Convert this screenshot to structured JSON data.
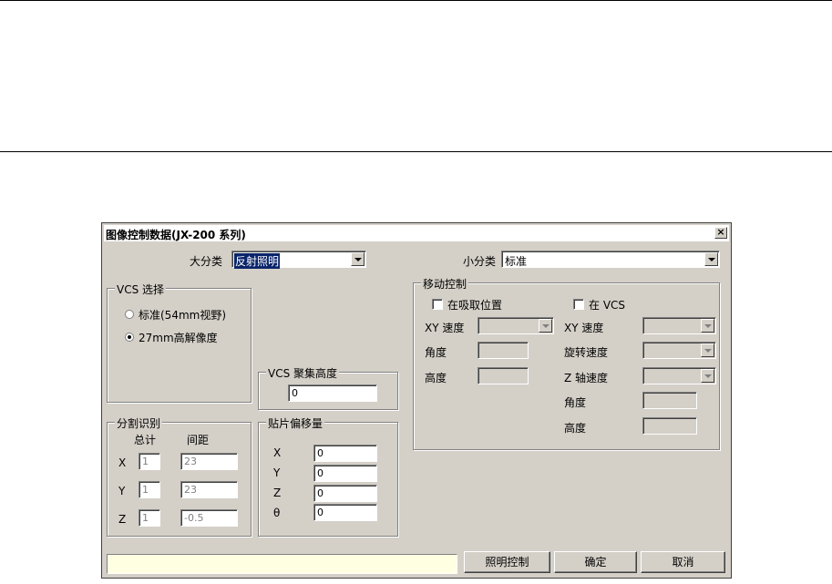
{
  "dialog": {
    "title": "图像控制数据(JX-200 系列)",
    "close_glyph": "×"
  },
  "category": {
    "major_label": "大分类",
    "major_value": "反射照明",
    "minor_label": "小分类",
    "minor_value": "标准"
  },
  "vcs_select": {
    "legend": "VCS 选择",
    "options": [
      {
        "label": "标准(54mm视野)",
        "checked": false
      },
      {
        "label": "27mm高解像度",
        "checked": true
      }
    ]
  },
  "vcs_focus": {
    "legend": "VCS 聚集高度",
    "value": "0"
  },
  "split": {
    "legend": "分割识别",
    "col_total": "总计",
    "col_pitch": "间距",
    "rows": [
      {
        "axis": "X",
        "total": "1",
        "pitch": "23"
      },
      {
        "axis": "Y",
        "total": "1",
        "pitch": "23"
      },
      {
        "axis": "Z",
        "total": "1",
        "pitch": "-0.5"
      }
    ]
  },
  "offset": {
    "legend": "贴片偏移量",
    "rows": [
      {
        "axis": "X",
        "value": "0"
      },
      {
        "axis": "Y",
        "value": "0"
      },
      {
        "axis": "Z",
        "value": "0"
      },
      {
        "axis": "θ",
        "value": "0"
      }
    ]
  },
  "move": {
    "legend": "移动控制",
    "pick_check": "在吸取位置",
    "vcs_check": "在 VCS",
    "left": {
      "xy_speed": "XY 速度",
      "angle": "角度",
      "height": "高度"
    },
    "right": {
      "xy_speed": "XY 速度",
      "rot_speed": "旋转速度",
      "z_speed": "Z 轴速度",
      "angle": "角度",
      "height": "高度"
    }
  },
  "buttons": {
    "light": "照明控制",
    "ok": "确定",
    "cancel": "取消"
  }
}
